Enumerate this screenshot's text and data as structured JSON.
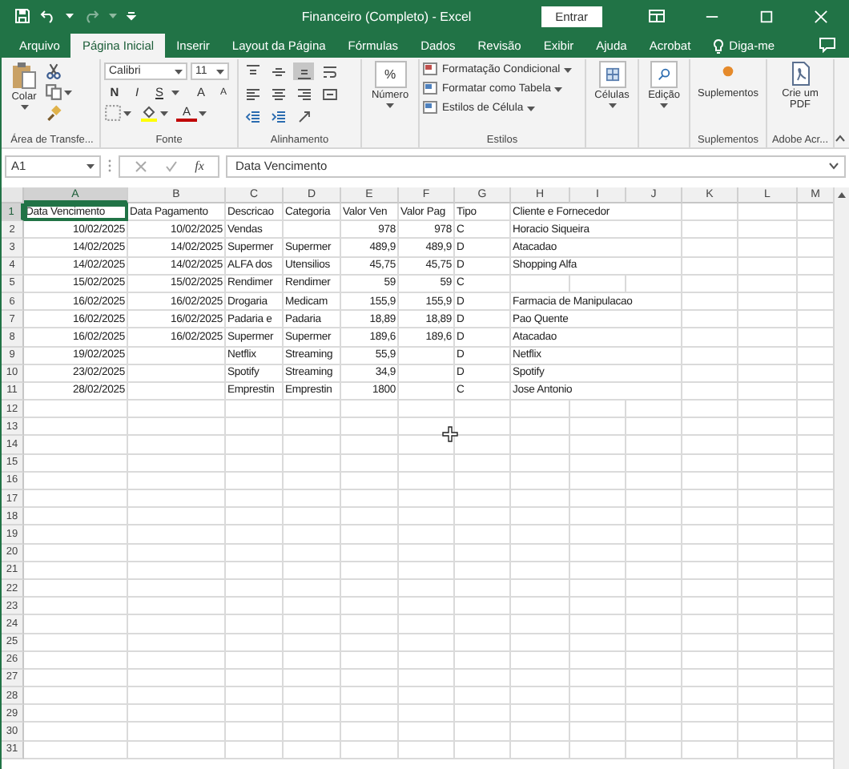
{
  "window": {
    "title": "Financeiro (Completo)  -  Excel",
    "sign_in": "Entrar"
  },
  "tabs": [
    {
      "label": "Arquivo",
      "selected": false
    },
    {
      "label": "Página Inicial",
      "selected": true
    },
    {
      "label": "Inserir",
      "selected": false
    },
    {
      "label": "Layout da Página",
      "selected": false
    },
    {
      "label": "Fórmulas",
      "selected": false
    },
    {
      "label": "Dados",
      "selected": false
    },
    {
      "label": "Revisão",
      "selected": false
    },
    {
      "label": "Exibir",
      "selected": false
    },
    {
      "label": "Ajuda",
      "selected": false
    },
    {
      "label": "Acrobat",
      "selected": false
    },
    {
      "label": "Diga-me",
      "selected": false
    }
  ],
  "ribbon": {
    "groups": [
      {
        "kind": "clipboard",
        "label": "Área de Transfe...",
        "button": "Colar"
      },
      {
        "kind": "font",
        "label": "Fonte",
        "font_name": "Calibri",
        "font_size": "11",
        "bold": "N",
        "italic": "I",
        "underline": "S",
        "grow": "A",
        "shrink": "A",
        "font_color": "A"
      },
      {
        "kind": "alignment",
        "label": "Alinhamento",
        "items": [
          {
            "kind": "top",
            "selected": false
          },
          {
            "kind": "middle",
            "selected": false
          },
          {
            "kind": "bottom",
            "selected": true
          },
          {
            "kind": "wrap",
            "selected": false
          },
          {
            "kind": "left",
            "selected": false
          },
          {
            "kind": "center",
            "selected": false
          },
          {
            "kind": "right",
            "selected": false
          },
          {
            "kind": "merge",
            "selected": false
          },
          {
            "kind": "outdent",
            "selected": false
          },
          {
            "kind": "indent",
            "selected": false
          },
          {
            "kind": "orientation",
            "selected": false
          }
        ]
      },
      {
        "kind": "number",
        "symbol": "%",
        "button": "Número"
      },
      {
        "kind": "styles",
        "label": "Estilos",
        "items": [
          "Formatação Condicional",
          "Formatar como Tabela",
          "Estilos de Célula"
        ]
      },
      {
        "kind": "cells",
        "button": "Células"
      },
      {
        "kind": "editing",
        "button": "Edição"
      },
      {
        "kind": "addins",
        "label": "Suplementos",
        "button": "Suplementos"
      },
      {
        "kind": "pdf",
        "label": "Adobe Acr...",
        "button": "Crie um PDF"
      }
    ]
  },
  "formula_bar": {
    "name_box": "A1",
    "function_label": "fx",
    "value": "Data Vencimento"
  },
  "columns": [
    {
      "label": "A",
      "selected": true
    },
    {
      "label": "B",
      "selected": false
    },
    {
      "label": "C",
      "selected": false
    },
    {
      "label": "D",
      "selected": false
    },
    {
      "label": "E",
      "selected": false
    },
    {
      "label": "F",
      "selected": false
    },
    {
      "label": "G",
      "selected": false
    },
    {
      "label": "H",
      "selected": false
    },
    {
      "label": "I",
      "selected": false
    },
    {
      "label": "J",
      "selected": false
    },
    {
      "label": "K",
      "selected": false
    },
    {
      "label": "L",
      "selected": false
    },
    {
      "label": "M",
      "selected": false
    }
  ],
  "rows": [
    {
      "number": "1",
      "selected": true,
      "cells": {
        "A": "Data Vencimento",
        "B": "Data Pagamento",
        "C": "Descricao",
        "D": "Categoria",
        "E": "Valor Ven",
        "F": "Valor Pag",
        "G": "Tipo",
        "H": "Cliente e Fornecedor"
      }
    },
    {
      "number": "2",
      "selected": false,
      "cells": {
        "A": "10/02/2025",
        "B": "10/02/2025",
        "C": "Vendas",
        "E": "978",
        "F": "978",
        "G": "C",
        "H": "Horacio Siqueira"
      }
    },
    {
      "number": "3",
      "selected": false,
      "cells": {
        "A": "14/02/2025",
        "B": "14/02/2025",
        "C": "Supermer",
        "D": "Supermer",
        "E": "489,9",
        "F": "489,9",
        "G": "D",
        "H": "Atacadao"
      }
    },
    {
      "number": "4",
      "selected": false,
      "cells": {
        "A": "14/02/2025",
        "B": "14/02/2025",
        "C": "ALFA dos",
        "D": "Utensilios",
        "E": "45,75",
        "F": "45,75",
        "G": "D",
        "H": "Shopping Alfa"
      }
    },
    {
      "number": "5",
      "selected": false,
      "cells": {
        "A": "15/02/2025",
        "B": "15/02/2025",
        "C": "Rendimer",
        "D": "Rendimer",
        "E": "59",
        "F": "59",
        "G": "C"
      }
    },
    {
      "number": "6",
      "selected": false,
      "cells": {
        "A": "16/02/2025",
        "B": "16/02/2025",
        "C": "Drogaria",
        "D": "Medicam",
        "E": "155,9",
        "F": "155,9",
        "G": "D",
        "H": "Farmacia de Manipulacao"
      }
    },
    {
      "number": "7",
      "selected": false,
      "cells": {
        "A": "16/02/2025",
        "B": "16/02/2025",
        "C": "Padaria e",
        "D": "Padaria",
        "E": "18,89",
        "F": "18,89",
        "G": "D",
        "H": "Pao Quente"
      }
    },
    {
      "number": "8",
      "selected": false,
      "cells": {
        "A": "16/02/2025",
        "B": "16/02/2025",
        "C": "Supermer",
        "D": "Supermer",
        "E": "189,6",
        "F": "189,6",
        "G": "D",
        "H": "Atacadao"
      }
    },
    {
      "number": "9",
      "selected": false,
      "cells": {
        "A": "19/02/2025",
        "C": "Netflix",
        "D": "Streaming",
        "E": "55,9",
        "G": "D",
        "H": "Netflix"
      }
    },
    {
      "number": "10",
      "selected": false,
      "cells": {
        "A": "23/02/2025",
        "C": "Spotify",
        "D": "Streaming",
        "E": "34,9",
        "G": "D",
        "H": "Spotify"
      }
    },
    {
      "number": "11",
      "selected": false,
      "cells": {
        "A": "28/02/2025",
        "C": "Emprestin",
        "D": "Emprestin",
        "E": "1800",
        "G": "C",
        "H": "Jose Antonio"
      }
    },
    {
      "number": "12",
      "selected": false
    },
    {
      "number": "13",
      "selected": false
    },
    {
      "number": "14",
      "selected": false
    },
    {
      "number": "15",
      "selected": false
    },
    {
      "number": "16",
      "selected": false
    },
    {
      "number": "17",
      "selected": false
    },
    {
      "number": "18",
      "selected": false
    },
    {
      "number": "19",
      "selected": false
    },
    {
      "number": "20",
      "selected": false
    },
    {
      "number": "21",
      "selected": false
    },
    {
      "number": "22",
      "selected": false
    },
    {
      "number": "23",
      "selected": false
    },
    {
      "number": "24",
      "selected": false
    },
    {
      "number": "25",
      "selected": false
    },
    {
      "number": "26",
      "selected": false
    },
    {
      "number": "27",
      "selected": false
    },
    {
      "number": "28",
      "selected": false
    },
    {
      "number": "29",
      "selected": false
    },
    {
      "number": "30",
      "selected": false
    },
    {
      "number": "31",
      "selected": false
    }
  ]
}
